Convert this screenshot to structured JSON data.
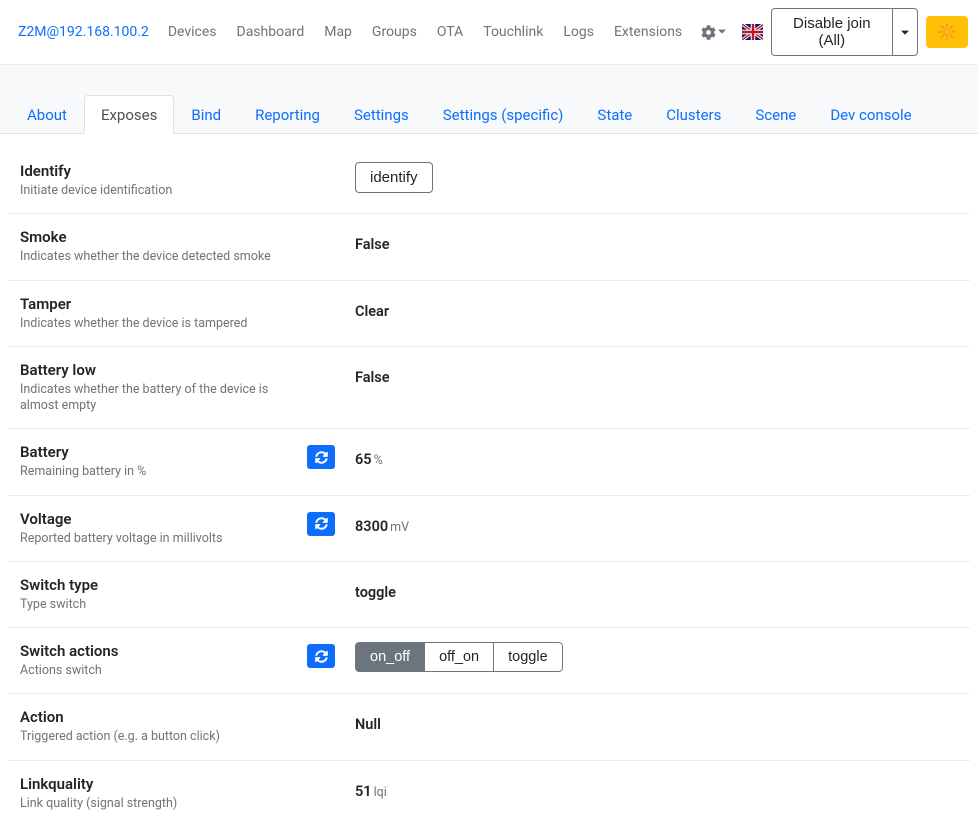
{
  "navbar": {
    "brand": "Z2M@192.168.100.2",
    "items": [
      "Devices",
      "Dashboard",
      "Map",
      "Groups",
      "OTA",
      "Touchlink",
      "Logs",
      "Extensions"
    ],
    "disable_join": "Disable join (All)"
  },
  "tabs": [
    "About",
    "Exposes",
    "Bind",
    "Reporting",
    "Settings",
    "Settings (specific)",
    "State",
    "Clusters",
    "Scene",
    "Dev console"
  ],
  "active_tab": 1,
  "rows": {
    "identify": {
      "title": "Identify",
      "desc": "Initiate device identification",
      "button": "identify"
    },
    "smoke": {
      "title": "Smoke",
      "desc": "Indicates whether the device detected smoke",
      "value": "False"
    },
    "tamper": {
      "title": "Tamper",
      "desc": "Indicates whether the device is tampered",
      "value": "Clear"
    },
    "battery_low": {
      "title": "Battery low",
      "desc": "Indicates whether the battery of the device is almost empty",
      "value": "False"
    },
    "battery": {
      "title": "Battery",
      "desc": "Remaining battery in %",
      "value": "65",
      "unit": "%"
    },
    "voltage": {
      "title": "Voltage",
      "desc": "Reported battery voltage in millivolts",
      "value": "8300",
      "unit": "mV"
    },
    "switch_type": {
      "title": "Switch type",
      "desc": "Type switch",
      "value": "toggle"
    },
    "switch_actions": {
      "title": "Switch actions",
      "desc": "Actions switch",
      "options": [
        "on_off",
        "off_on",
        "toggle"
      ],
      "active": 0
    },
    "action": {
      "title": "Action",
      "desc": "Triggered action (e.g. a button click)",
      "value": "Null"
    },
    "linkquality": {
      "title": "Linkquality",
      "desc": "Link quality (signal strength)",
      "value": "51",
      "unit": "lqi"
    }
  }
}
